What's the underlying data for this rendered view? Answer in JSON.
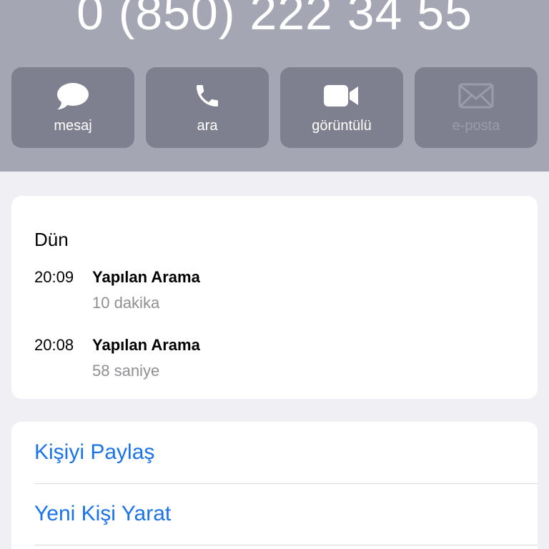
{
  "contact": {
    "phone_number": "0 (850) 222 34 55"
  },
  "actions": [
    {
      "label": "mesaj",
      "icon": "message-bubble-icon",
      "enabled": true
    },
    {
      "label": "ara",
      "icon": "phone-icon",
      "enabled": true
    },
    {
      "label": "görüntülü",
      "icon": "video-camera-icon",
      "enabled": true
    },
    {
      "label": "e-posta",
      "icon": "envelope-icon",
      "enabled": false
    }
  ],
  "recents": {
    "day": "Dün",
    "calls": [
      {
        "time": "20:09",
        "type": "Yapılan Arama",
        "duration": "10 dakika"
      },
      {
        "time": "20:08",
        "type": "Yapılan Arama",
        "duration": "58 saniye"
      }
    ]
  },
  "links": {
    "share_contact": "Kişiyi Paylaş",
    "create_new_contact": "Yeni Kişi Yarat"
  },
  "colors": {
    "header_bg": "#a4a6b3",
    "action_button_bg": "#7e8090",
    "link_blue": "#1a73e8",
    "page_bg": "#efeff4"
  }
}
